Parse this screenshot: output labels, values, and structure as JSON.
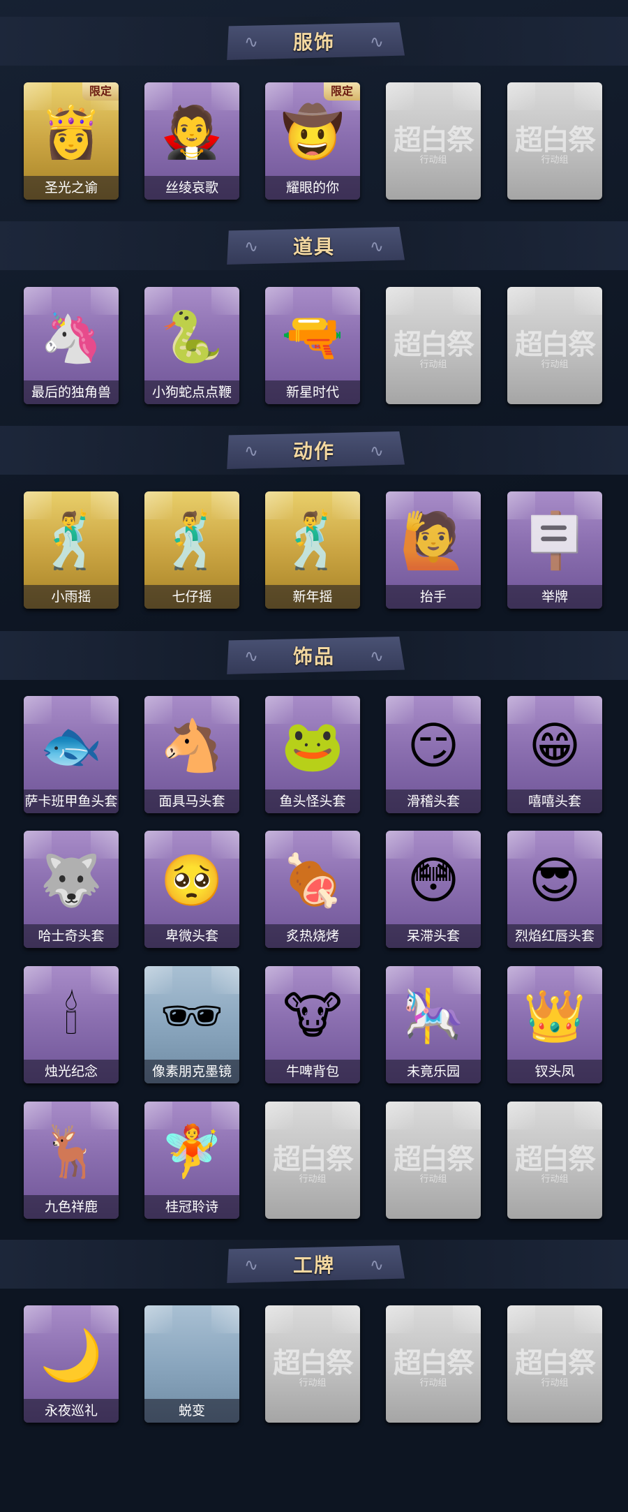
{
  "sections": [
    {
      "title": "服饰",
      "items": [
        {
          "label": "圣光之谕",
          "tier": "gold",
          "badge": "限定",
          "icon": "blonde-doll-icon"
        },
        {
          "label": "丝绫哀歌",
          "tier": "purple",
          "badge": "",
          "icon": "gothic-doll-icon"
        },
        {
          "label": "耀眼的你",
          "tier": "purple",
          "badge": "限定",
          "icon": "cowgirl-doll-icon"
        },
        {
          "label": "",
          "tier": "grey",
          "badge": "",
          "icon": "locked-placeholder-icon"
        },
        {
          "label": "",
          "tier": "grey",
          "badge": "",
          "icon": "locked-placeholder-icon"
        }
      ]
    },
    {
      "title": "道具",
      "items": [
        {
          "label": "最后的独角兽",
          "tier": "purple",
          "badge": "",
          "icon": "unicorn-lance-icon"
        },
        {
          "label": "小狗蛇点点鞭",
          "tier": "purple",
          "badge": "",
          "icon": "snake-whip-icon"
        },
        {
          "label": "新星时代",
          "tier": "purple",
          "badge": "",
          "icon": "revolver-icon"
        },
        {
          "label": "",
          "tier": "grey",
          "badge": "",
          "icon": "locked-placeholder-icon"
        },
        {
          "label": "",
          "tier": "grey",
          "badge": "",
          "icon": "locked-placeholder-icon"
        }
      ]
    },
    {
      "title": "动作",
      "items": [
        {
          "label": "小雨摇",
          "tier": "gold",
          "badge": "",
          "icon": "dance-pose-icon"
        },
        {
          "label": "七仔摇",
          "tier": "gold",
          "badge": "",
          "icon": "dance-pose-icon"
        },
        {
          "label": "新年摇",
          "tier": "gold",
          "badge": "",
          "icon": "dance-pose-icon"
        },
        {
          "label": "抬手",
          "tier": "purple",
          "badge": "",
          "icon": "raise-hand-pose-icon"
        },
        {
          "label": "举牌",
          "tier": "purple",
          "badge": "",
          "icon": "hold-sign-pose-icon"
        }
      ]
    },
    {
      "title": "饰品",
      "items": [
        {
          "label": "萨卡班甲鱼头套",
          "tier": "purple",
          "badge": "",
          "icon": "fish-head-icon"
        },
        {
          "label": "面具马头套",
          "tier": "purple",
          "badge": "",
          "icon": "horse-head-icon"
        },
        {
          "label": "鱼头怪头套",
          "tier": "purple",
          "badge": "",
          "icon": "fish-monster-icon"
        },
        {
          "label": "滑稽头套",
          "tier": "purple",
          "badge": "",
          "icon": "smirk-emoji-icon"
        },
        {
          "label": "嘻嘻头套",
          "tier": "purple",
          "badge": "",
          "icon": "grin-emoji-icon"
        },
        {
          "label": "哈士奇头套",
          "tier": "purple",
          "badge": "",
          "icon": "husky-head-icon"
        },
        {
          "label": "卑微头套",
          "tier": "purple",
          "badge": "",
          "icon": "humble-emoji-icon"
        },
        {
          "label": "炙热烧烤",
          "tier": "purple",
          "badge": "",
          "icon": "bbq-meat-icon"
        },
        {
          "label": "呆滞头套",
          "tier": "purple",
          "badge": "",
          "icon": "blank-emoji-icon"
        },
        {
          "label": "烈焰红唇头套",
          "tier": "purple",
          "badge": "",
          "icon": "yellow-mask-icon"
        },
        {
          "label": "烛光纪念",
          "tier": "purple",
          "badge": "",
          "icon": "candle-icon"
        },
        {
          "label": "像素朋克墨镜",
          "tier": "blue",
          "badge": "",
          "icon": "pixel-sunglasses-icon"
        },
        {
          "label": "牛啤背包",
          "tier": "purple",
          "badge": "",
          "icon": "cow-beer-backpack-icon"
        },
        {
          "label": "未竟乐园",
          "tier": "purple",
          "badge": "",
          "icon": "amusement-doll-icon"
        },
        {
          "label": "钗头凤",
          "tier": "purple",
          "badge": "",
          "icon": "phoenix-hairpin-icon"
        },
        {
          "label": "九色祥鹿",
          "tier": "purple",
          "badge": "",
          "icon": "deer-icon"
        },
        {
          "label": "桂冠聆诗",
          "tier": "purple",
          "badge": "",
          "icon": "laurel-fairy-icon"
        },
        {
          "label": "",
          "tier": "grey",
          "badge": "",
          "icon": "locked-placeholder-icon"
        },
        {
          "label": "",
          "tier": "grey",
          "badge": "",
          "icon": "locked-placeholder-icon"
        },
        {
          "label": "",
          "tier": "grey",
          "badge": "",
          "icon": "locked-placeholder-icon"
        }
      ]
    },
    {
      "title": "工牌",
      "items": [
        {
          "label": "永夜巡礼",
          "tier": "purple",
          "badge": "",
          "icon": "night-badge-icon"
        },
        {
          "label": "蜕变",
          "tier": "blue",
          "badge": "",
          "icon": "blank-badge-icon"
        },
        {
          "label": "",
          "tier": "grey",
          "badge": "",
          "icon": "locked-placeholder-icon"
        },
        {
          "label": "",
          "tier": "grey",
          "badge": "",
          "icon": "locked-placeholder-icon"
        },
        {
          "label": "",
          "tier": "grey",
          "badge": "",
          "icon": "locked-placeholder-icon"
        }
      ]
    }
  ],
  "placeholder": {
    "watermark": "超白祭",
    "subtitle": "行动组"
  },
  "colors": {
    "background": "#0d1522",
    "banner_title": "#f3d8a1",
    "banner_plate": "#3e4566"
  }
}
